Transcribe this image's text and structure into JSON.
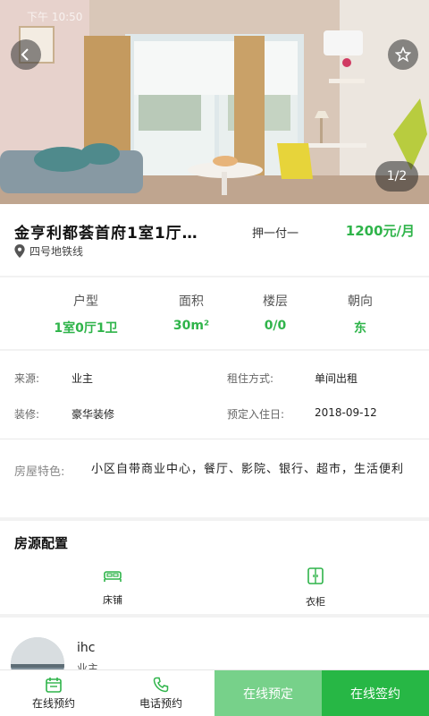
{
  "status_bar": {
    "time": "下午 10:50"
  },
  "hero": {
    "counter": "1/2"
  },
  "listing": {
    "title": "金亨利都荟首府1室1厅…",
    "deposit": "押一付一",
    "price": "1200元/月",
    "location": "四号地铁线"
  },
  "stats": [
    {
      "label": "户型",
      "value": "1室0厅1卫"
    },
    {
      "label": "面积",
      "value": "30m²"
    },
    {
      "label": "楼层",
      "value": "0/0"
    },
    {
      "label": "朝向",
      "value": "东"
    }
  ],
  "details": {
    "source_label": "来源:",
    "source_value": "业主",
    "rent_mode_label": "租住方式:",
    "rent_mode_value": "单间出租",
    "decor_label": "装修:",
    "decor_value": "豪华装修",
    "move_in_label": "预定入住日:",
    "move_in_value": "2018-09-12",
    "feature_label": "房屋特色:",
    "feature_value": "小区自带商业中心，餐厅、影院、银行、超市，生活便利"
  },
  "config": {
    "title": "房源配置",
    "items": [
      {
        "label": "床铺",
        "icon": "bed-icon"
      },
      {
        "label": "衣柜",
        "icon": "wardrobe-icon"
      }
    ]
  },
  "agent": {
    "name": "ihc",
    "role": "业主"
  },
  "bottom_bar": {
    "online_appointment": "在线预约",
    "phone_appointment": "电话预约",
    "online_reserve": "在线预定",
    "online_sign": "在线签约"
  },
  "colors": {
    "accent": "#27b745",
    "accent_light": "#77d18a",
    "price": "#2fb44a"
  }
}
